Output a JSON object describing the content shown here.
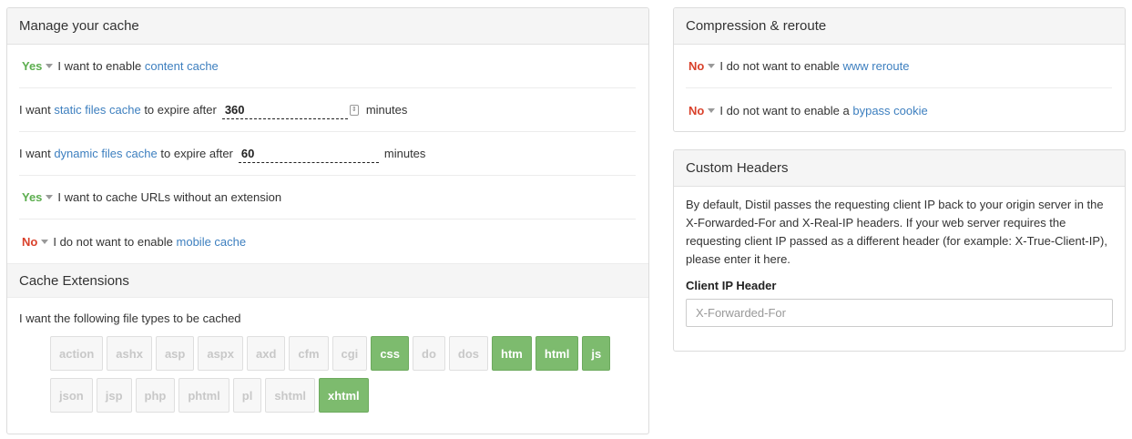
{
  "manage": {
    "title": "Manage your cache",
    "content_cache": {
      "toggle": "Yes",
      "text": "I want to enable",
      "link": "content cache"
    },
    "static_cache": {
      "pre": "I want",
      "link": "static files cache",
      "mid": "to expire after",
      "value": "360",
      "unit": "minutes"
    },
    "dynamic_cache": {
      "pre": "I want",
      "link": "dynamic files cache",
      "mid": "to expire after",
      "value": "60",
      "unit": "minutes"
    },
    "no_extension": {
      "toggle": "Yes",
      "text": "I want to cache URLs without an extension"
    },
    "mobile_cache": {
      "toggle": "No",
      "text": "I do not want to enable",
      "link": "mobile cache"
    }
  },
  "extensions": {
    "title": "Cache Extensions",
    "label": "I want the following file types to be cached",
    "rows": [
      [
        {
          "name": "action",
          "on": false
        },
        {
          "name": "ashx",
          "on": false
        },
        {
          "name": "asp",
          "on": false
        },
        {
          "name": "aspx",
          "on": false
        },
        {
          "name": "axd",
          "on": false
        },
        {
          "name": "cfm",
          "on": false
        },
        {
          "name": "cgi",
          "on": false
        },
        {
          "name": "css",
          "on": true
        },
        {
          "name": "do",
          "on": false
        },
        {
          "name": "dos",
          "on": false
        },
        {
          "name": "htm",
          "on": true
        },
        {
          "name": "html",
          "on": true
        },
        {
          "name": "js",
          "on": true
        }
      ],
      [
        {
          "name": "json",
          "on": false
        },
        {
          "name": "jsp",
          "on": false
        },
        {
          "name": "php",
          "on": false
        },
        {
          "name": "phtml",
          "on": false
        },
        {
          "name": "pl",
          "on": false
        },
        {
          "name": "shtml",
          "on": false
        },
        {
          "name": "xhtml",
          "on": true
        }
      ]
    ]
  },
  "compression": {
    "title": "Compression & reroute",
    "www_reroute": {
      "toggle": "No",
      "text": "I do not want to enable",
      "link": "www reroute"
    },
    "bypass_cookie": {
      "toggle": "No",
      "text": "I do not want to enable a",
      "link": "bypass cookie"
    }
  },
  "headers": {
    "title": "Custom Headers",
    "description": "By default, Distil passes the requesting client IP back to your origin server in the X-Forwarded-For and X-Real-IP headers. If your web server requires the requesting client IP passed as a different header (for example: X-True-Client-IP), please enter it here.",
    "field_label": "Client IP Header",
    "placeholder": "X-Forwarded-For"
  },
  "colors": {
    "yes": "#5cae4f",
    "no": "#d9412b",
    "link": "#3d7fbf",
    "chip_on": "#7dbb6e"
  }
}
